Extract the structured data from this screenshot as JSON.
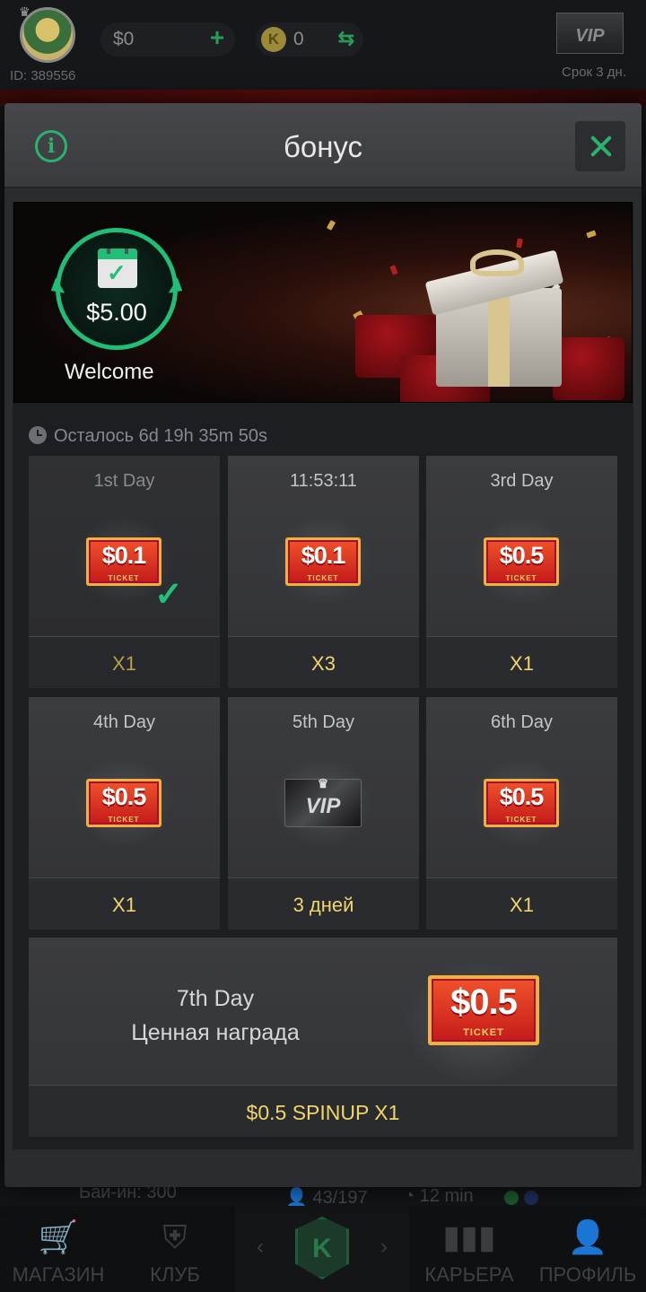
{
  "topbar": {
    "user_id": "ID: 389556",
    "balance": "$0",
    "balance_add": "+",
    "coins_icon": "K",
    "coins": "0",
    "vip_label": "VIP",
    "vip_term": "Срок 3 дн."
  },
  "lobby": {
    "buyin": "Бай-ин: 300",
    "players": "43/197",
    "time": "12 min"
  },
  "modal": {
    "title": "бонус",
    "banner": {
      "amount": "$5.00",
      "caption": "Welcome"
    },
    "countdown": "Осталось 6d 19h 35m 50s",
    "days": [
      {
        "label": "1st Day",
        "reward": "$0.1",
        "ticket_word": "TICKET",
        "multiplier": "X1",
        "claimed": true
      },
      {
        "label": "11:53:11",
        "reward": "$0.1",
        "ticket_word": "TICKET",
        "multiplier": "X3",
        "claimed": false
      },
      {
        "label": "3rd Day",
        "reward": "$0.5",
        "ticket_word": "TICKET",
        "multiplier": "X1",
        "claimed": false
      },
      {
        "label": "4th Day",
        "reward": "$0.5",
        "ticket_word": "TICKET",
        "multiplier": "X1",
        "claimed": false
      },
      {
        "label": "5th Day",
        "reward": "VIP",
        "multiplier": "3 дней",
        "claimed": false
      },
      {
        "label": "6th Day",
        "reward": "$0.5",
        "ticket_word": "TICKET",
        "multiplier": "X1",
        "claimed": false
      }
    ],
    "grand": {
      "label": "7th Day",
      "sublabel": "Ценная награда",
      "reward": "$0.5",
      "ticket_word": "TICKET",
      "multiplier": "$0.5 SPINUP X1"
    }
  },
  "nav": {
    "shop": "МАГАЗИН",
    "club": "КЛУБ",
    "career": "КАРЬЕРА",
    "profile": "ПРОФИЛЬ",
    "center_logo": "K"
  },
  "colors": {
    "accent": "#29b36e",
    "gold_text": "#f0d66a",
    "ticket_red": "#d42a1e"
  }
}
